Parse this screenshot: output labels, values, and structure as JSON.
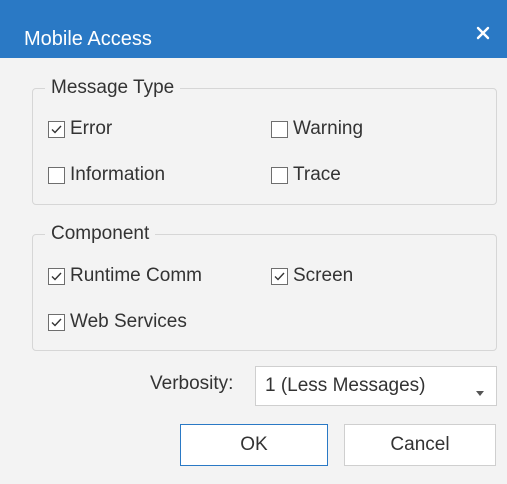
{
  "window": {
    "title": "Mobile Access",
    "close_icon": "close-icon",
    "accent_color": "#2a79c5"
  },
  "message_type": {
    "label": "Message Type",
    "items": [
      {
        "label": "Error",
        "checked": true
      },
      {
        "label": "Warning",
        "checked": false
      },
      {
        "label": "Information",
        "checked": false
      },
      {
        "label": "Trace",
        "checked": false
      }
    ]
  },
  "component": {
    "label": "Component",
    "items": [
      {
        "label": "Runtime Comm",
        "checked": true
      },
      {
        "label": "Screen",
        "checked": true
      },
      {
        "label": "Web Services",
        "checked": true
      }
    ]
  },
  "verbosity": {
    "label": "Verbosity:",
    "value": "1 (Less Messages)"
  },
  "buttons": {
    "ok": "OK",
    "cancel": "Cancel"
  }
}
